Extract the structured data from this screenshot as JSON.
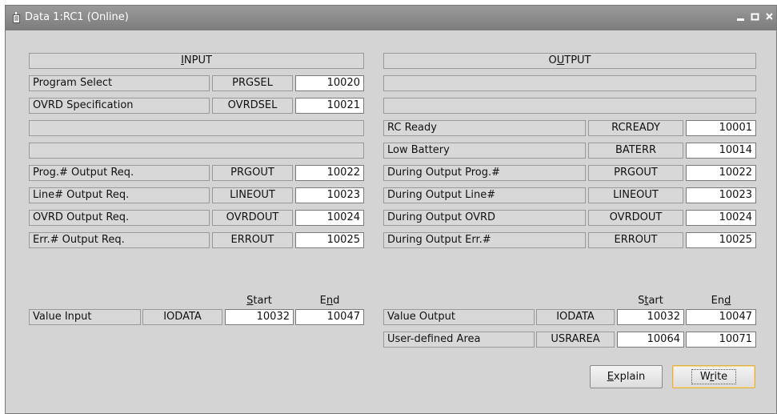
{
  "window": {
    "title": "Data 1:RC1 (Online)"
  },
  "input": {
    "header_pre": "",
    "header_u": "I",
    "header_post": "NPUT",
    "rows": [
      {
        "label": "Program Select",
        "signal": "PRGSEL",
        "value": "10020"
      },
      {
        "label": "OVRD Specification",
        "signal": "OVRDSEL",
        "value": "10021"
      },
      {
        "label": "Prog.# Output Req.",
        "signal": "PRGOUT",
        "value": "10022"
      },
      {
        "label": "Line# Output Req.",
        "signal": "LINEOUT",
        "value": "10023"
      },
      {
        "label": "OVRD Output Req.",
        "signal": "OVRDOUT",
        "value": "10024"
      },
      {
        "label": "Err.# Output Req.",
        "signal": "ERROUT",
        "value": "10025"
      }
    ],
    "range": {
      "start_header_u": "S",
      "start_header_rest": "tart",
      "end_header_pre": "E",
      "end_header_u": "n",
      "end_header_post": "d",
      "label": "Value Input",
      "signal": "IODATA",
      "start": "10032",
      "end": "10047"
    }
  },
  "output": {
    "header_pre": "O",
    "header_u": "U",
    "header_post": "TPUT",
    "rows": [
      {
        "label": "RC Ready",
        "signal": "RCREADY",
        "value": "10001"
      },
      {
        "label": "Low Battery",
        "signal": "BATERR",
        "value": "10014"
      },
      {
        "label": "During Output Prog.#",
        "signal": "PRGOUT",
        "value": "10022"
      },
      {
        "label": "During Output Line#",
        "signal": "LINEOUT",
        "value": "10023"
      },
      {
        "label": "During Output OVRD",
        "signal": "OVRDOUT",
        "value": "10024"
      },
      {
        "label": "During Output Err.#",
        "signal": "ERROUT",
        "value": "10025"
      }
    ],
    "range": {
      "start_header_pre": "S",
      "start_header_u": "t",
      "start_header_post": "art",
      "end_header_pre": "En",
      "end_header_u": "d",
      "rows": [
        {
          "label": "Value Output",
          "signal": "IODATA",
          "start": "10032",
          "end": "10047"
        },
        {
          "label": "User-defined Area",
          "signal": "USRAREA",
          "start": "10064",
          "end": "10071"
        }
      ]
    }
  },
  "buttons": {
    "explain_u": "E",
    "explain_rest": "xplain",
    "write_pre": "W",
    "write_u": "r",
    "write_post": "ite"
  }
}
